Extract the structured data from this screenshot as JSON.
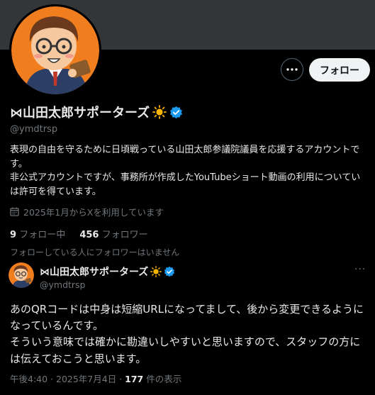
{
  "profile": {
    "display_name": "⋈山田太郎サポーターズ",
    "handle": "@ymdtrsp",
    "bio_lines": [
      "表現の自由を守るために日頃戦っている山田太郎参議院議員を応援するアカウントで",
      "す。",
      "非公式アカウントですが、事務所が作成したYouTubeショート動画の利用についてい",
      "は許可を得ています。"
    ],
    "joined": "2025年1月からXを利用しています",
    "following_count": "9",
    "following_label": "フォロー中",
    "followers_count": "456",
    "followers_label": "フォロワー",
    "followers_you_know": "フォローしている人にフォロワーはいません"
  },
  "actions": {
    "follow_label": "フォロー",
    "more_icon": "more-horizontal-icon"
  },
  "tweet": {
    "display_name": "⋈山田太郎サポーターズ",
    "handle": "@ymdtrsp",
    "more_icon": "···",
    "text_lines": [
      "あのQRコードは中身は短縮URLになってまして、後から変更できるように",
      "なっているんです。",
      "そういう意味では確かに勘違いしやすいと思いますので、スタッフの方に",
      "は伝えておこうと思います。"
    ],
    "time": "午後4:40",
    "sep": " · ",
    "date": "2025年7月4日",
    "views_count": "177",
    "views_label": "件の表示"
  },
  "colors": {
    "background": "#000000",
    "banner": "#333639",
    "text": "#e7e9ea",
    "muted": "#71767b",
    "verified": "#1d9bf0",
    "avatar_bg": "#f07d1e"
  },
  "icons": [
    "sun-emoji-icon",
    "verified-badge-icon",
    "calendar-icon",
    "avatar-illustration"
  ]
}
